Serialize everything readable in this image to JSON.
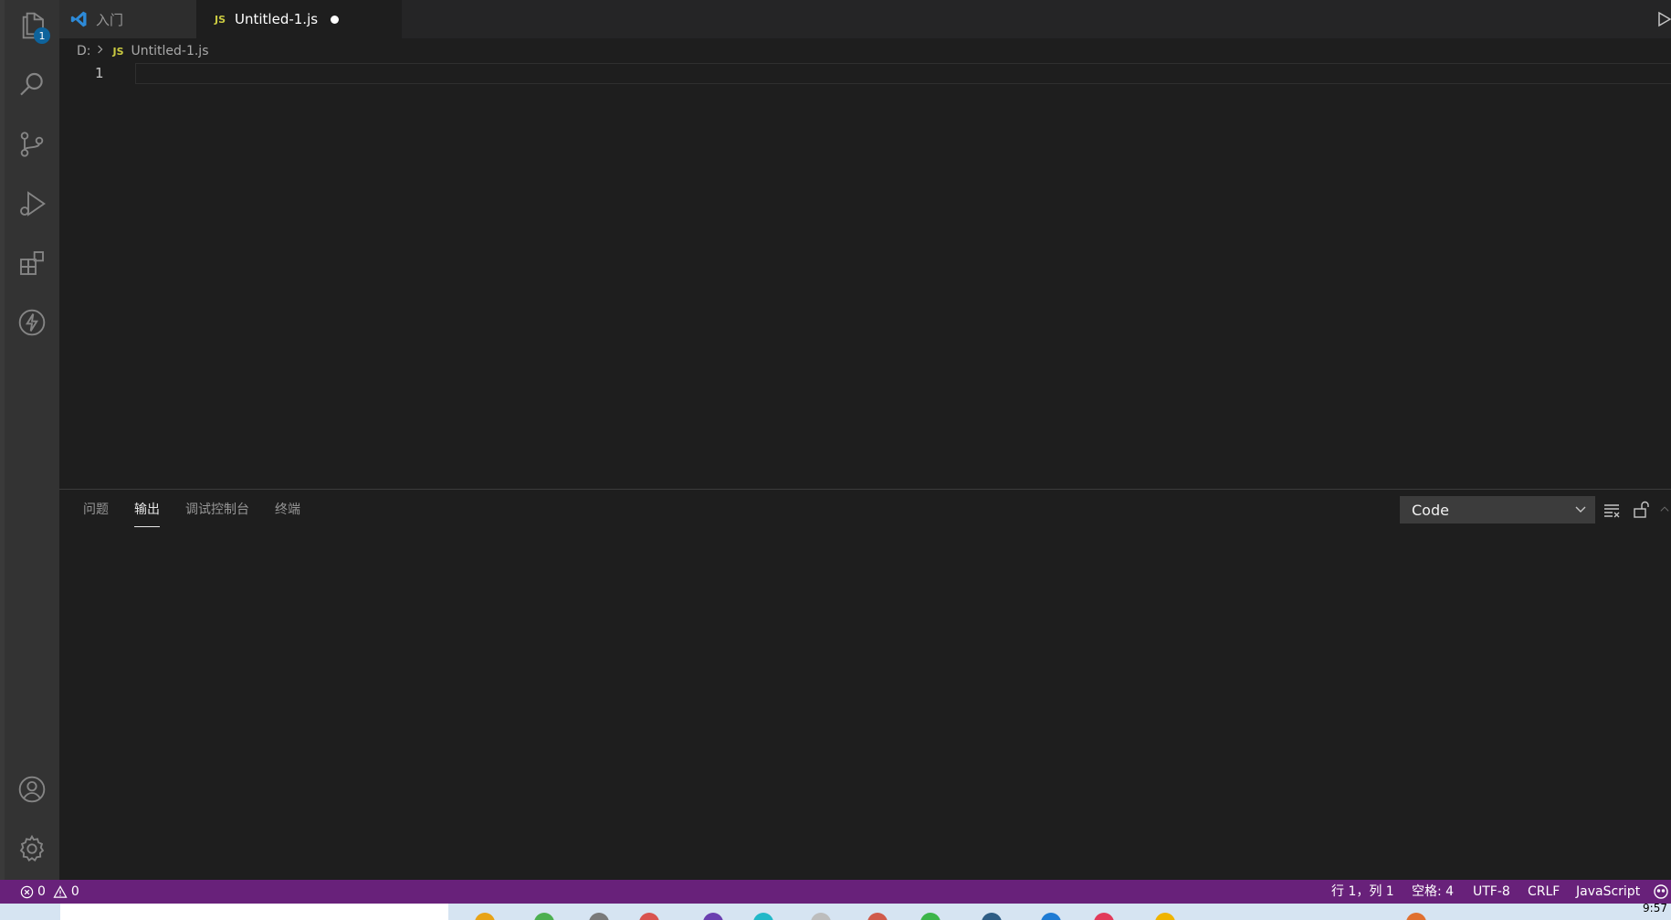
{
  "tabs": {
    "welcome_label": "入门",
    "file_label": "Untitled-1.js",
    "file_lang_badge": "JS"
  },
  "breadcrumb": {
    "drive": "D:",
    "lang_badge": "JS",
    "file": "Untitled-1.js"
  },
  "editor": {
    "line_number": "1"
  },
  "activity_bar": {
    "explorer_badge": "1",
    "icons": [
      "files-icon",
      "search-icon",
      "source-control-icon",
      "run-debug-icon",
      "extensions-icon",
      "lightning-icon",
      "account-icon",
      "gear-icon"
    ]
  },
  "panel": {
    "tabs": [
      "问题",
      "输出",
      "调试控制台",
      "终端"
    ],
    "active_tab": "输出",
    "output_channel": "Code"
  },
  "status_bar": {
    "errors": "0",
    "warnings": "0",
    "position": "行 1，列 1",
    "spaces": "空格: 4",
    "encoding": "UTF-8",
    "eol": "CRLF",
    "language": "JavaScript"
  },
  "taskbar": {
    "clock": "9:57"
  },
  "colors": {
    "editor_bg": "#1e1e1e",
    "activity_bg": "#333333",
    "status_bg": "#68217a",
    "badge_bg": "#0e639c",
    "js_icon": "#cbcb41"
  }
}
